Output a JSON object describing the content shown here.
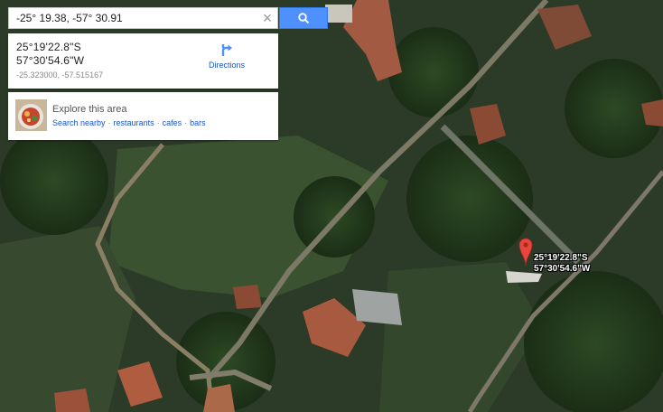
{
  "search": {
    "query": "-25° 19.38, -57° 30.91",
    "clear_icon": "close-icon",
    "search_icon": "search-icon",
    "button_color": "#4d90fe"
  },
  "location": {
    "latitude_dms": "25°19'22.8\"S",
    "longitude_dms": "57°30'54.6\"W",
    "decimal": "-25.323000, -57.515167",
    "directions_label": "Directions",
    "directions_icon": "directions-arrow-icon",
    "link_color": "#1a55c8"
  },
  "explore": {
    "title": "Explore this area",
    "links": [
      "Search nearby",
      "restaurants",
      "cafes",
      "bars"
    ],
    "thumbnail_icon": "food-plate-thumbnail"
  },
  "marker": {
    "latitude_dms": "25°19'22.8\"S",
    "longitude_dms": "57°30'54.6\"W",
    "icon": "map-pin-icon",
    "color": "#e8453c"
  },
  "map": {
    "view": "satellite"
  }
}
